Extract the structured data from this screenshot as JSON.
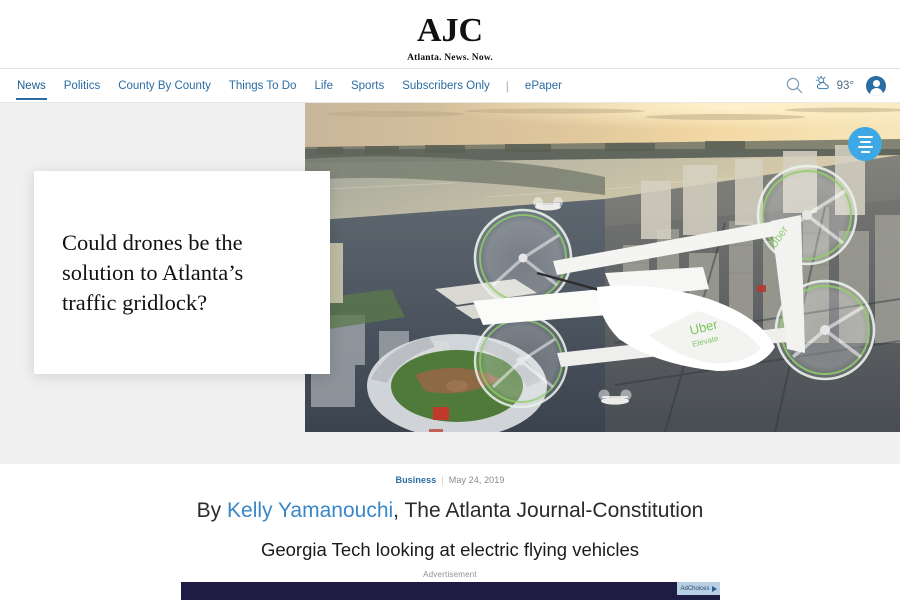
{
  "brand": {
    "logo_text": "AJC",
    "tagline": "Atlanta. News. Now."
  },
  "nav": {
    "items": [
      {
        "label": "News",
        "active": true
      },
      {
        "label": "Politics",
        "active": false
      },
      {
        "label": "County By County",
        "active": false
      },
      {
        "label": "Things To Do",
        "active": false
      },
      {
        "label": "Life",
        "active": false
      },
      {
        "label": "Sports",
        "active": false
      },
      {
        "label": "Subscribers Only",
        "active": false
      }
    ],
    "separator": "|",
    "epaper": "ePaper",
    "search_icon": "search-icon",
    "weather": {
      "icon": "sun-behind-cloud-icon",
      "temperature": "93°"
    },
    "account_icon": "user-avatar-icon"
  },
  "hero": {
    "headline": "Could drones be the solution to Atlanta’s traffic gridlock?",
    "fab_icon": "list-menu-icon",
    "image_alt": "Aerial view of a city at sunset with a white electric flying vehicle"
  },
  "article": {
    "category": "Business",
    "separator": "|",
    "date": "May 24, 2019",
    "byline_prefix": "By ",
    "author": "Kelly Yamanouchi",
    "publication": ", The Atlanta Journal-Constitution",
    "subheadline": "Georgia Tech looking at electric flying vehicles"
  },
  "ad": {
    "label": "Advertisement",
    "adchoices_label": "AdChoices",
    "banner_color": "#1e1b45"
  },
  "colors": {
    "link_blue": "#2b6ca3",
    "author_blue": "#3a86c8",
    "fab_blue": "#3ea8e5",
    "page_bg": "#f0f0f0"
  }
}
